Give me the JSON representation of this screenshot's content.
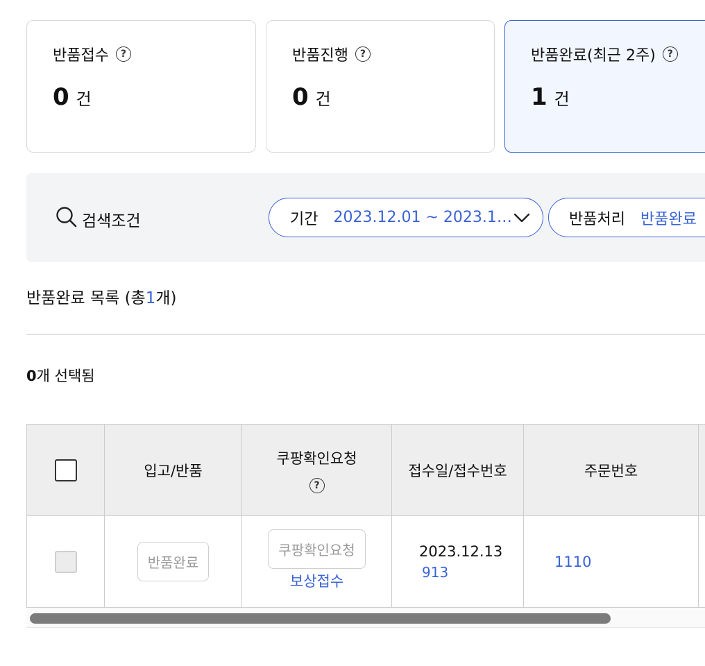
{
  "status_cards": [
    {
      "title": "반품접수",
      "count": "0",
      "unit": "건"
    },
    {
      "title": "반품진행",
      "count": "0",
      "unit": "건"
    },
    {
      "title": "반품완료(최근 2주)",
      "count": "1",
      "unit": "건"
    }
  ],
  "help_glyph": "?",
  "search": {
    "label": "검색조건",
    "filters": [
      {
        "label": "기간",
        "value": "2023.12.01 ~ 2023.1…"
      },
      {
        "label": "반품처리",
        "value": "반품완료"
      }
    ]
  },
  "list": {
    "title_prefix": "반품완료 목록 (총",
    "count": "1",
    "title_suffix": "개)",
    "selected_count": "0",
    "selected_suffix": "개 선택됨"
  },
  "table": {
    "headers": {
      "col_inout": "입고/반품",
      "col_confirm": "쿠팡확인요청",
      "col_receipt": "접수일/접수번호",
      "col_order": "주문번호"
    },
    "rows": [
      {
        "status_button": "반품완료",
        "confirm_button": "쿠팡확인요청",
        "confirm_link": "보상접수",
        "receipt_date": "2023.12.13",
        "receipt_number": "913",
        "order_number": "1110"
      }
    ]
  },
  "colors": {
    "accent": "#3a63d6",
    "active_card_bg": "#f1f6ff",
    "panel_bg": "#f3f4f5",
    "header_bg": "#eeeeee"
  }
}
